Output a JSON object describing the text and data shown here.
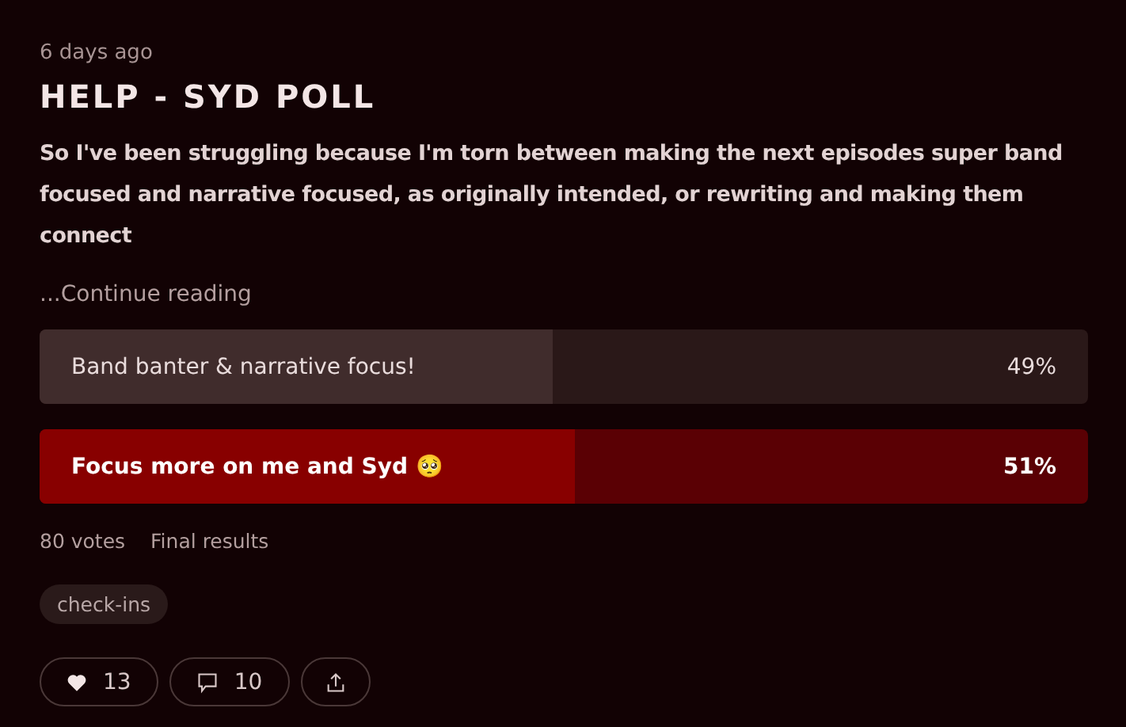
{
  "post": {
    "date": "6 days ago",
    "title": "HELP - SYD POLL",
    "body": "So I've been struggling because I'm torn between making the next episodes super band focused and narrative focused, as originally intended, or rewriting and making them connect",
    "continue": "...Continue reading"
  },
  "poll": {
    "options": [
      {
        "label": "Band banter & narrative focus!",
        "percent": "49%",
        "level": 0.49,
        "selected": false
      },
      {
        "label": "Focus more on me and Syd 🥺",
        "percent": "51%",
        "level": 0.51,
        "selected": true
      }
    ],
    "votes": "80 votes",
    "status": "Final results"
  },
  "tags": [
    "check-ins"
  ],
  "actions": {
    "likes": "13",
    "comments": "10"
  }
}
